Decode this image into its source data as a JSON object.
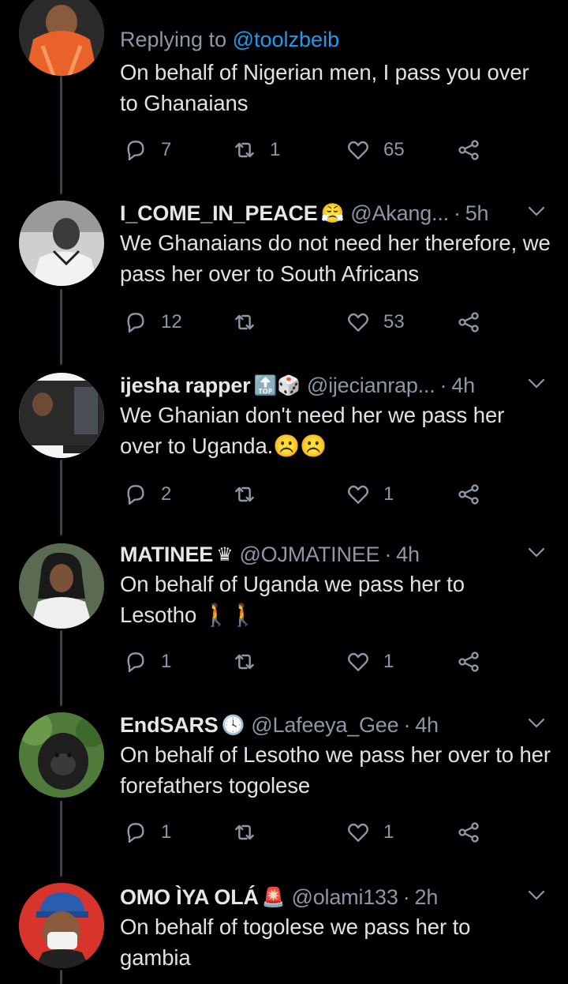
{
  "tweets": [
    {
      "reply_prefix": "Replying to ",
      "reply_mention": "@toolzbeib",
      "text": "On behalf of Nigerian men, I pass you over to Ghanaians",
      "replies": "7",
      "retweets": "1",
      "likes": "65"
    },
    {
      "name": "I_COME_IN_PEACE",
      "emoji": "😤",
      "handle": "@Akang...",
      "time": "5h",
      "text": "We Ghanaians do not need her therefore, we pass her over to South Africans",
      "replies": "12",
      "retweets": "",
      "likes": "53"
    },
    {
      "name": "ijesha rapper",
      "emoji": "🔝🎲",
      "handle": "@ijecianrap...",
      "time": "4h",
      "text": "We Ghanian don't need her we pass her over to Uganda.☹️☹️",
      "replies": "2",
      "retweets": "",
      "likes": "1"
    },
    {
      "name": "MATINEE",
      "emoji": "♛",
      "handle": "@OJMATINEE",
      "time": "4h",
      "text": "On behalf of Uganda we pass her to Lesotho 🚶🚶",
      "replies": "1",
      "retweets": "",
      "likes": "1"
    },
    {
      "name": "EndSARS",
      "emoji": "🕓",
      "handle": "@Lafeeya_Gee",
      "time": "4h",
      "text": "On behalf of Lesotho we pass her over to her forefathers togolese",
      "replies": "1",
      "retweets": "",
      "likes": "1"
    },
    {
      "name": "OMO ÌYA OLÁ",
      "emoji": "🚨",
      "handle": "@olami133",
      "time": "2h",
      "text": "On behalf of togolese we pass her to gambia"
    }
  ],
  "icons": {
    "reply": "reply-icon",
    "retweet": "retweet-icon",
    "like": "heart-icon",
    "share": "share-icon",
    "more": "chevron-down-icon"
  },
  "colors": {
    "background": "#000000",
    "thread_line": "#3d4148",
    "secondary_text": "#8b98a5",
    "mention": "#1d9bf0"
  }
}
